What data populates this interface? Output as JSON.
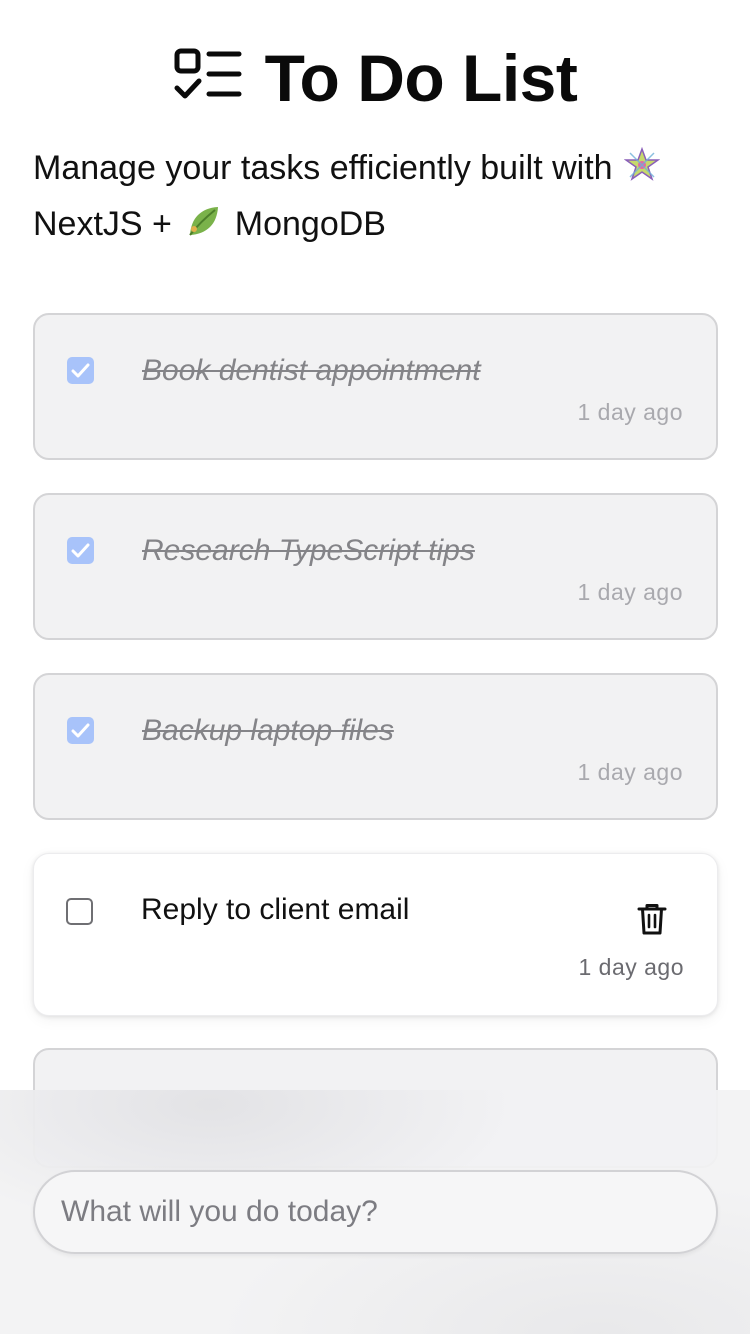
{
  "app": {
    "title": "To Do List",
    "subtitle_part1": "Manage your tasks efficiently built with ",
    "subtitle_part2": " NextJS + ",
    "subtitle_part3": " MongoDB"
  },
  "tasks": [
    {
      "title": "Book dentist appointment",
      "time": "1 day ago",
      "completed": true
    },
    {
      "title": "Research TypeScript tips",
      "time": "1 day ago",
      "completed": true
    },
    {
      "title": "Backup laptop files",
      "time": "1 day ago",
      "completed": true
    },
    {
      "title": "Reply to client email",
      "time": "1 day ago",
      "completed": false
    }
  ],
  "input": {
    "placeholder": "What will you do today?",
    "value": ""
  },
  "icons": {
    "logo": "checklist-icon",
    "subtitle_star": "sparkle-star-icon",
    "subtitle_leaf": "leaf-icon",
    "delete": "trash-icon"
  },
  "colors": {
    "checkbox_checked": "#a8c3fa",
    "completed_card_bg": "#f2f2f3",
    "completed_text": "#848488",
    "time_text": "#a9a9ae"
  }
}
